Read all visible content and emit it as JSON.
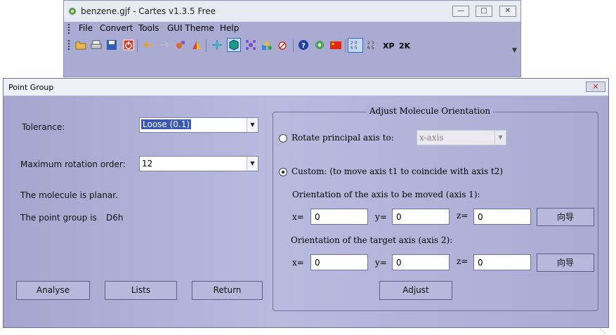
{
  "main_window": {
    "title": "benzene.gjf - Cartes v1.3.5 Free",
    "menu": [
      "File",
      "Convert",
      "Tools",
      "GUI Theme",
      "Help"
    ],
    "toolbar_text_buttons": [
      "XP",
      "2K"
    ]
  },
  "dialog": {
    "title": "Point Group",
    "tolerance_label": "Tolerance:",
    "tolerance_value": "Loose (0.1)",
    "max_rotation_label": "Maximum rotation order:",
    "max_rotation_value": "12",
    "planar_text": "The molecule is planar.",
    "point_group_label": "The point group is",
    "point_group_value": "D6h",
    "buttons": {
      "analyse": "Analyse",
      "lists": "Lists",
      "return": "Return"
    },
    "orientation": {
      "legend": "Adjust Molecule Orientation",
      "rotate_label": "Rotate principal axis to:",
      "rotate_value": "x-axis",
      "custom_label": "Custom: (to move axis t1 to coincide with axis t2)",
      "axis1_label": "Orientation of the axis to be moved (axis 1):",
      "axis2_label": "Orientation of the target axis (axis 2):",
      "x_label": "x=",
      "y_label": "y=",
      "z_label": "z=",
      "axis1": {
        "x": "0",
        "y": "0",
        "z": "0"
      },
      "axis2": {
        "x": "0",
        "y": "0",
        "z": "0"
      },
      "wizard_label": "向导",
      "adjust_label": "Adjust",
      "selected_mode": "custom"
    }
  },
  "colors": {
    "window_body": "#a9abd2",
    "dialog_body": "#b4b6da",
    "selection": "#3a57b3"
  }
}
